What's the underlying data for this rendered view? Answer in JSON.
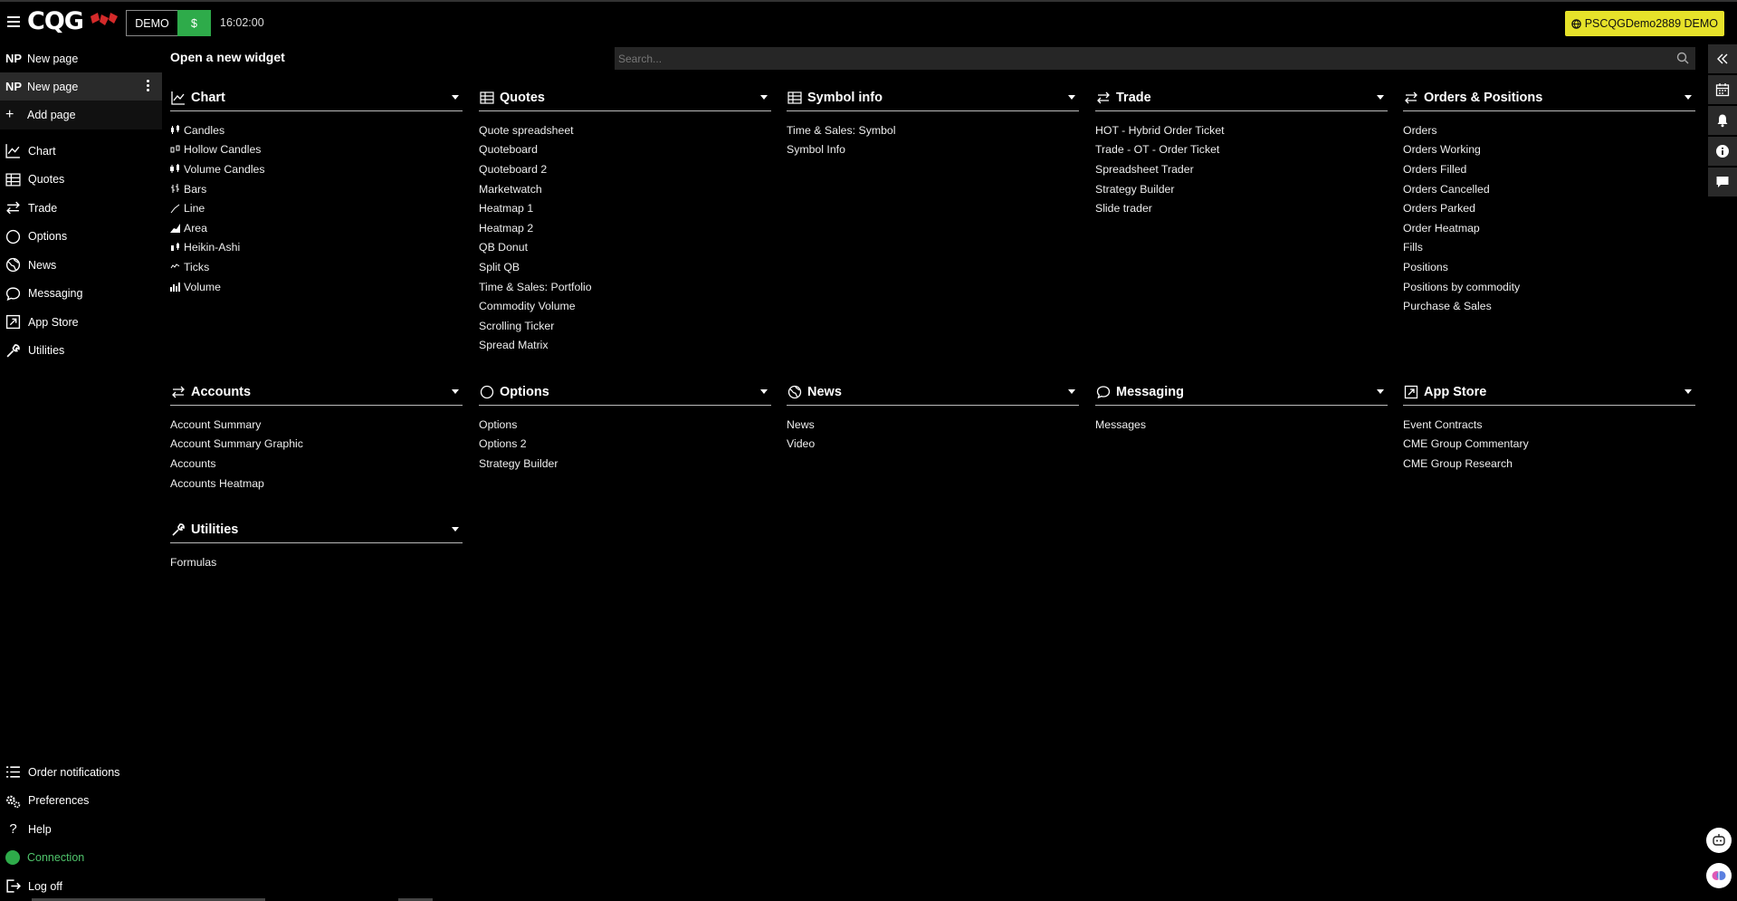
{
  "header": {
    "logo": "CQG",
    "demo_label": "DEMO",
    "dollar_label": "$",
    "clock": "16:02:00",
    "user_badge": "PSCQGDemo2889 DEMO",
    "accent_green": "#2eab4a",
    "badge_yellow": "#e6e22a"
  },
  "sidebar": {
    "pages": [
      {
        "abbr": "NP",
        "label": "New page",
        "active": false
      },
      {
        "abbr": "NP",
        "label": "New page",
        "active": true
      }
    ],
    "add_page": "Add page",
    "nav": [
      {
        "label": "Chart",
        "icon": "chart-line-icon"
      },
      {
        "label": "Quotes",
        "icon": "table-icon"
      },
      {
        "label": "Trade",
        "icon": "arrows-exchange-icon"
      },
      {
        "label": "Options",
        "icon": "circle-icon"
      },
      {
        "label": "News",
        "icon": "globe-icon"
      },
      {
        "label": "Messaging",
        "icon": "chat-bubble-icon"
      },
      {
        "label": "App Store",
        "icon": "external-link-icon"
      },
      {
        "label": "Utilities",
        "icon": "wrench-icon"
      }
    ],
    "bottom": [
      {
        "label": "Order notifications",
        "icon": "list-icon"
      },
      {
        "label": "Preferences",
        "icon": "gears-icon"
      },
      {
        "label": "Help",
        "icon": "question-icon"
      },
      {
        "label": "Connection",
        "icon": "status-dot-icon"
      },
      {
        "label": "Log off",
        "icon": "logout-icon"
      }
    ]
  },
  "main": {
    "title": "Open a new widget",
    "search_placeholder": "Search...",
    "sections": {
      "chart": {
        "title": "Chart",
        "items": [
          "Candles",
          "Hollow Candles",
          "Volume Candles",
          "Bars",
          "Line",
          "Area",
          "Heikin-Ashi",
          "Ticks",
          "Volume"
        ]
      },
      "quotes": {
        "title": "Quotes",
        "items": [
          "Quote spreadsheet",
          "Quoteboard",
          "Quoteboard 2",
          "Marketwatch",
          "Heatmap 1",
          "Heatmap 2",
          "QB Donut",
          "Split QB",
          "Time & Sales: Portfolio",
          "Commodity Volume",
          "Scrolling Ticker",
          "Spread Matrix"
        ]
      },
      "symbol_info": {
        "title": "Symbol info",
        "items": [
          "Time & Sales: Symbol",
          "Symbol Info"
        ]
      },
      "trade": {
        "title": "Trade",
        "items": [
          "HOT - Hybrid Order Ticket",
          "Trade - OT - Order Ticket",
          "Spreadsheet Trader",
          "Strategy Builder",
          "Slide trader"
        ]
      },
      "orders": {
        "title": "Orders & Positions",
        "items": [
          "Orders",
          "Orders Working",
          "Orders Filled",
          "Orders Cancelled",
          "Orders Parked",
          "Order Heatmap",
          "Fills",
          "Positions",
          "Positions by commodity",
          "Purchase & Sales"
        ]
      },
      "accounts": {
        "title": "Accounts",
        "items": [
          "Account Summary",
          "Account Summary Graphic",
          "Accounts",
          "Accounts Heatmap"
        ]
      },
      "options": {
        "title": "Options",
        "items": [
          "Options",
          "Options 2",
          "Strategy Builder"
        ]
      },
      "news": {
        "title": "News",
        "items": [
          "News",
          "Video"
        ]
      },
      "messaging": {
        "title": "Messaging",
        "items": [
          "Messages"
        ]
      },
      "appstore": {
        "title": "App Store",
        "items": [
          "Event Contracts",
          "CME Group Commentary",
          "CME Group Research"
        ]
      },
      "utilities": {
        "title": "Utilities",
        "items": [
          "Formulas"
        ]
      }
    }
  },
  "rail": [
    {
      "icon": "collapse-icon"
    },
    {
      "icon": "calendar-icon"
    },
    {
      "icon": "bell-icon"
    },
    {
      "icon": "info-icon"
    },
    {
      "icon": "comment-icon"
    }
  ]
}
